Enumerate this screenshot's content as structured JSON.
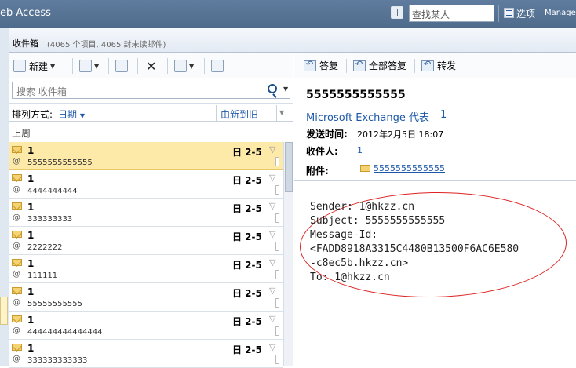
{
  "app": {
    "title": "eb Access",
    "search_placeholder": "查找某人",
    "options_label": "选项",
    "manage_label": "Manage"
  },
  "folder": {
    "name": "收件箱",
    "count_text": "(4065 个项目, 4065 封未读邮件)"
  },
  "toolbar": {
    "new_label": "新建"
  },
  "list": {
    "search_placeholder": "搜索 收件箱",
    "sort_label": "排列方式:",
    "sort_by": "日期",
    "sort_order": "由新到旧",
    "group_label": "上周",
    "rows": [
      {
        "sender": "1",
        "subject": "5555555555555",
        "date": "日 2-5"
      },
      {
        "sender": "1",
        "subject": "4444444444",
        "date": "日 2-5"
      },
      {
        "sender": "1",
        "subject": "333333333",
        "date": "日 2-5"
      },
      {
        "sender": "1",
        "subject": "2222222",
        "date": "日 2-5"
      },
      {
        "sender": "1",
        "subject": "111111",
        "date": "日 2-5"
      },
      {
        "sender": "1",
        "subject": "55555555555",
        "date": "日 2-5"
      },
      {
        "sender": "1",
        "subject": "444444444444444",
        "date": "日 2-5"
      },
      {
        "sender": "1",
        "subject": "333333333333",
        "date": "日 2-5"
      }
    ]
  },
  "reading": {
    "reply_label": "答复",
    "reply_all_label": "全部答复",
    "forward_label": "转发",
    "subject": "5555555555555",
    "from": "Microsoft Exchange 代表",
    "from_count": "1",
    "sent_label": "发送时间:",
    "sent_value": "2012年2月5日 18:07",
    "to_label": "收件人:",
    "to_value": "1",
    "attach_label": "附件:",
    "attach_name": "5555555555555",
    "body_lines": [
      "Sender: 1@hkzz.cn",
      "Subject: 5555555555555",
      "Message-Id:",
      "<FADD8918A3315C4480B13500F6AC6E580",
      "-c8ec5b.hkzz.cn>",
      "To: 1@hkzz.cn"
    ]
  },
  "colors": {
    "accent": "#1d58a8",
    "selected_row": "#fde9a8",
    "title_bar": "#5f7c9e",
    "annotation": "#dd2222"
  }
}
